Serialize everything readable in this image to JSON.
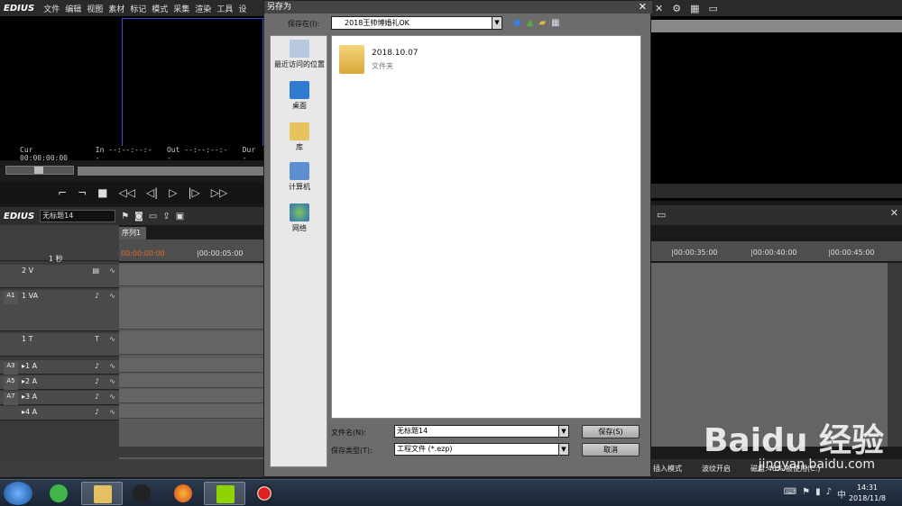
{
  "edius": {
    "logo": "EDIUS",
    "menu": [
      "文件",
      "编辑",
      "视图",
      "素材",
      "标记",
      "模式",
      "采集",
      "渲染",
      "工具",
      "设"
    ],
    "timecode": {
      "cur": "Cur 00:00:00:00",
      "in": "In --:--:--:--",
      "out": "Out --:--:--:--",
      "dur": "Dur -"
    },
    "project_name": "无标题14",
    "sequence_tab": "序列1",
    "ruler": {
      "start": "00:00:00:00",
      "t5": "|00:00:05:00",
      "t35": "|00:00:35:00",
      "t40": "|00:00:40:00",
      "t45": "|00:00:45:00"
    },
    "scale": "1 秒",
    "tracks": [
      {
        "label": "2 V",
        "side": ""
      },
      {
        "label": "1 VA",
        "side": "A1"
      },
      {
        "label": "1 T",
        "side": ""
      },
      {
        "label": "▸1 A",
        "side": "A3"
      },
      {
        "label": "▸2 A",
        "side": "A5"
      },
      {
        "label": "▸3 A",
        "side": "A7"
      },
      {
        "label": "▸4 A",
        "side": ""
      }
    ],
    "status": {
      "insert_mode": "插入模式",
      "ripple": "波纹开启",
      "disk": "磁盘:46% 被使用(C:)"
    }
  },
  "dialog": {
    "title": "另存为",
    "save_in_label": "保存在(I):",
    "location": "2018王帅博婚礼OK",
    "places": [
      "最近访问的位置",
      "桌面",
      "库",
      "计算机",
      "网络"
    ],
    "files": [
      {
        "name": "2018.10.07",
        "type": "文件夹"
      }
    ],
    "filename_label": "文件名(N):",
    "filename_value": "无标题14",
    "filetype_label": "保存类型(T):",
    "filetype_value": "工程文件 (*.ezp)",
    "save_button": "保存(S)",
    "cancel_button": "取消"
  },
  "taskbar": {
    "time": "14:31",
    "date": "2018/11/8"
  },
  "watermark": {
    "brand": "Baidu 经验",
    "url": "jingyan.baidu.com"
  }
}
